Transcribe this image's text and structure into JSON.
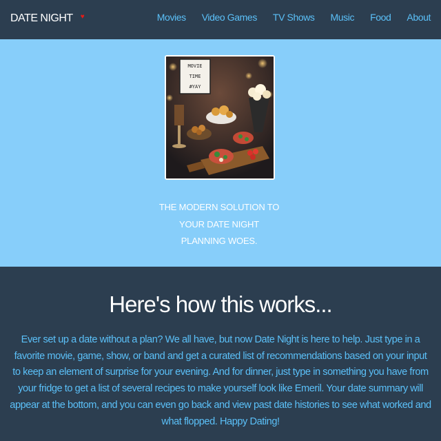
{
  "navbar": {
    "brand": "DATE NIGHT",
    "brand_icon": "heart-icon",
    "links": [
      "Movies",
      "Video Games",
      "TV Shows",
      "Music",
      "Food",
      "About"
    ]
  },
  "hero": {
    "image_sign_lines": [
      "MOVIE",
      "TIME",
      "#YAY"
    ],
    "tagline_lines": [
      "THE MODERN SOLUTION TO",
      "YOUR DATE NIGHT",
      "PLANNING WOES."
    ]
  },
  "how": {
    "title": "Here's how this works...",
    "body": "Ever set up a date without a plan? We all have, but now Date Night is here to help. Just type in a favorite movie, game, show, or band and get a curated list of recommendations based on your input to keep an element of surprise for your evening. And for dinner, just type in something you have from your fridge to get a list of several recipes to make yourself look like Emeril. Your date summary will appear at the bottom, and you can even go back and view past date histories to see what worked and what flopped. Happy Dating!"
  },
  "colors": {
    "navbar_bg": "#2c3e50",
    "hero_bg": "#87cefa",
    "link": "#5bc0f8",
    "heart": "#e41b17"
  }
}
